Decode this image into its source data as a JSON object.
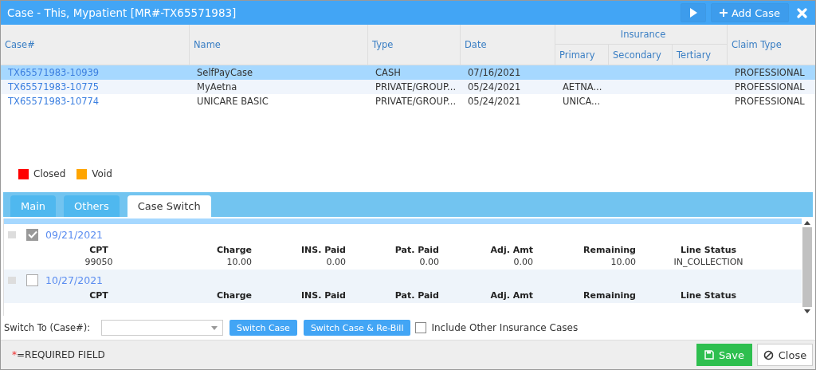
{
  "window": {
    "title": "Case - This, Mypatient [MR#-TX65571983]",
    "add_button": "Add Case"
  },
  "table": {
    "columns": [
      {
        "label": "Case#"
      },
      {
        "label": "Name"
      },
      {
        "label": "Type"
      },
      {
        "label": "Date"
      }
    ],
    "group": {
      "label": "Insurance",
      "columns": [
        "Primary",
        "Secondary",
        "Tertiary"
      ]
    },
    "last_column": "Claim Type",
    "rows": [
      {
        "case": "TX65571983-10939",
        "name": "SelfPayCase",
        "type": "CASH",
        "date": "07/16/2021",
        "primary": "",
        "secondary": "",
        "tertiary": "",
        "claim_type": "PROFESSIONAL",
        "selected": true
      },
      {
        "case": "TX65571983-10775",
        "name": "MyAetna",
        "type": "PRIVATE/GROUP...",
        "date": "05/24/2021",
        "primary": "AETNA...",
        "secondary": "",
        "tertiary": "",
        "claim_type": "PROFESSIONAL",
        "selected": false
      },
      {
        "case": "TX65571983-10774",
        "name": "UNICARE BASIC",
        "type": "PRIVATE/GROUP...",
        "date": "05/24/2021",
        "primary": "UNICA...",
        "secondary": "",
        "tertiary": "",
        "claim_type": "PROFESSIONAL",
        "selected": false
      }
    ]
  },
  "legend": [
    {
      "label": "Closed",
      "color": "#ff0000"
    },
    {
      "label": "Void",
      "color": "#ffa500"
    }
  ],
  "tabs": [
    {
      "label": "Main",
      "selected": false
    },
    {
      "label": "Others",
      "selected": false
    },
    {
      "label": "Case Switch",
      "selected": true
    }
  ],
  "items": [
    {
      "date": "09/21/2021",
      "checked": true,
      "headers": [
        "CPT",
        "Charge",
        "INS. Paid",
        "Pat. Paid",
        "Adj. Amt",
        "Remaining",
        "Line Status"
      ],
      "values": [
        "99050",
        "10.00",
        "0.00",
        "0.00",
        "0.00",
        "10.00",
        "IN_COLLECTION"
      ]
    },
    {
      "date": "10/27/2021",
      "checked": false,
      "headers": [
        "CPT",
        "Charge",
        "INS. Paid",
        "Pat. Paid",
        "Adj. Amt",
        "Remaining",
        "Line Status"
      ]
    }
  ],
  "switch": {
    "label": "Switch To (Case#):",
    "buttons": [
      "Switch Case",
      "Switch Case & Re-Bill"
    ],
    "include_label": "Include Other Insurance Cases",
    "include_checked": false
  },
  "footer": {
    "required_mark": "*",
    "required_label": "=REQUIRED FIELD",
    "save": "Save",
    "close": "Close"
  }
}
